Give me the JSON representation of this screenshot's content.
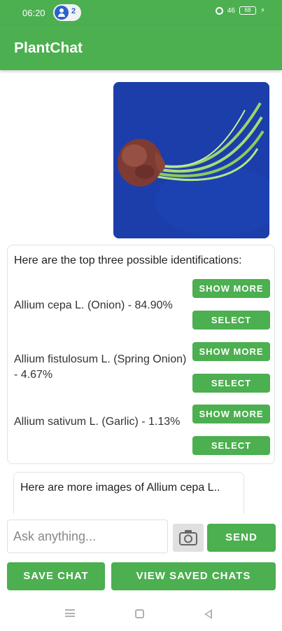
{
  "status_bar": {
    "time": "06:20",
    "notification_count": "2",
    "network_label": "46",
    "battery_level": "68"
  },
  "app_bar": {
    "title": "PlantChat"
  },
  "chat": {
    "image_icon": "onion-photo",
    "results": {
      "heading": "Here are the top three possible identifications:",
      "items": [
        {
          "label": "Allium cepa L. (Onion) - 84.90%",
          "show_more": "SHOW MORE",
          "select": "SELECT"
        },
        {
          "label": "Allium fistulosum L. (Spring Onion) - 4.67%",
          "show_more": "SHOW MORE",
          "select": "SELECT"
        },
        {
          "label": "Allium sativum L. (Garlic) - 1.13%",
          "show_more": "SHOW MORE",
          "select": "SELECT"
        }
      ]
    },
    "more_images_text": "Here are more images of Allium cepa L.."
  },
  "input": {
    "placeholder": "Ask anything...",
    "value": "",
    "camera_icon": "camera-icon",
    "send_label": "SEND"
  },
  "actions": {
    "save_chat_label": "SAVE CHAT",
    "view_saved_label": "VIEW SAVED CHATS"
  },
  "nav": {
    "icons": [
      "menu-icon",
      "home-icon",
      "back-icon"
    ]
  },
  "colors": {
    "primary": "#4caf50",
    "image_background": "#1b3eab"
  }
}
